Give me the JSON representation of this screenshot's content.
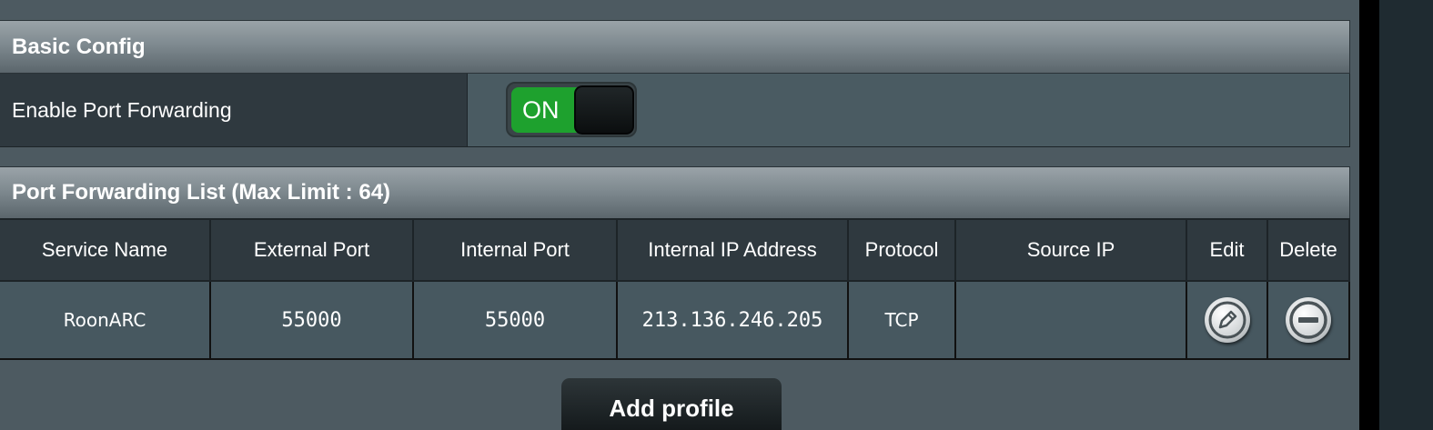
{
  "basic_config": {
    "title": "Basic Config",
    "enable_label": "Enable Port Forwarding",
    "toggle_state": "ON"
  },
  "port_forwarding": {
    "title": "Port Forwarding List (Max Limit : 64)",
    "columns": [
      "Service Name",
      "External Port",
      "Internal Port",
      "Internal IP Address",
      "Protocol",
      "Source IP",
      "Edit",
      "Delete"
    ],
    "rows": [
      {
        "service_name": "RoonARC",
        "external_port": "55000",
        "internal_port": "55000",
        "internal_ip": "213.136.246.205",
        "protocol": "TCP",
        "source_ip": ""
      }
    ],
    "icons": {
      "edit": "pencil-icon",
      "delete": "minus-circle-icon"
    }
  },
  "add_profile_label": "Add profile"
}
